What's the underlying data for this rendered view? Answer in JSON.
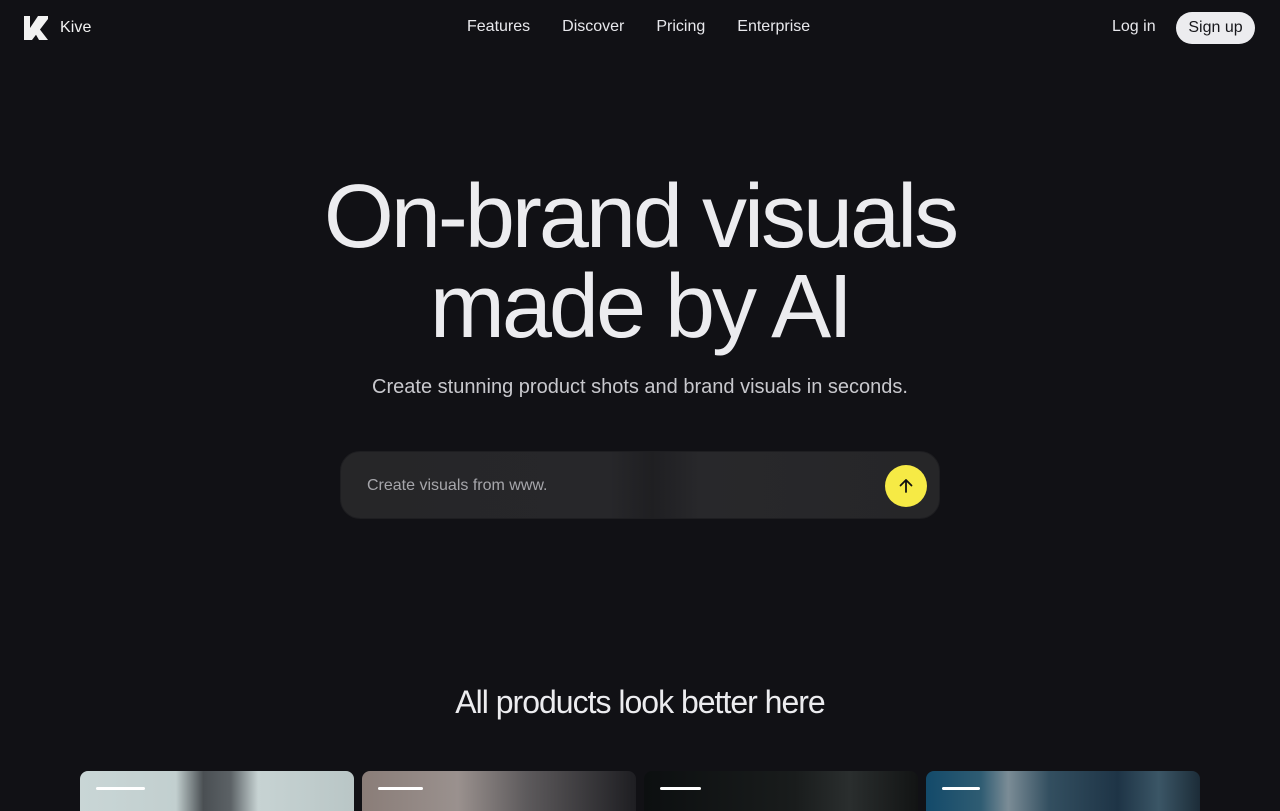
{
  "nav": {
    "brand": "Kive",
    "links": [
      "Features",
      "Discover",
      "Pricing",
      "Enterprise"
    ],
    "login": "Log in",
    "signup": "Sign up"
  },
  "hero": {
    "title_line1": "On-brand visuals",
    "title_line2": "made by AI",
    "subtitle": "Create stunning product shots and brand visuals in seconds."
  },
  "prompt": {
    "placeholder": "Create visuals from www.",
    "submit_icon": "arrow-up-icon",
    "accent": "#f6ea45"
  },
  "showcase": {
    "title": "All products look better here",
    "cards": [
      "card-1",
      "card-2",
      "card-3",
      "card-4"
    ]
  }
}
